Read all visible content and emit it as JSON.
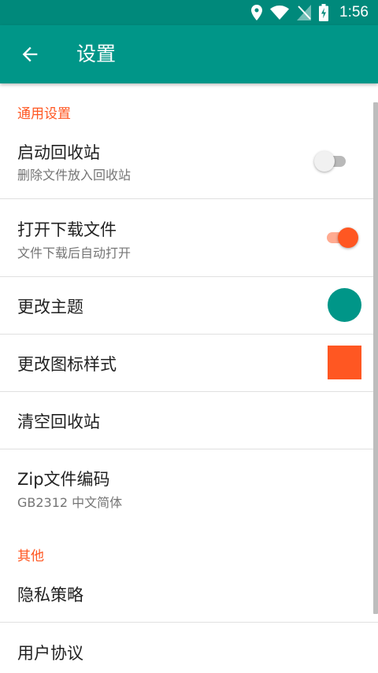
{
  "status_bar": {
    "time": "1:56",
    "icons": [
      "location-icon",
      "wifi-icon",
      "no-sim-icon",
      "battery-charging-icon"
    ]
  },
  "app_bar": {
    "title": "设置",
    "back_icon": "arrow-back-icon"
  },
  "colors": {
    "primary": "#009688",
    "primary_dark": "#00897b",
    "accent": "#ff5722"
  },
  "sections": {
    "general": {
      "header": "通用设置",
      "recycle_bin": {
        "title": "启动回收站",
        "subtitle": "删除文件放入回收站",
        "checked": false
      },
      "open_download": {
        "title": "打开下载文件",
        "subtitle": "文件下载后自动打开",
        "checked": true
      },
      "theme": {
        "title": "更改主题",
        "color": "#009688"
      },
      "icon_style": {
        "title": "更改图标样式",
        "color": "#ff5722"
      },
      "clear_bin": {
        "title": "清空回收站"
      },
      "zip_encoding": {
        "title": "Zip文件编码",
        "subtitle": "GB2312 中文简体"
      }
    },
    "other": {
      "header": "其他",
      "privacy": {
        "title": "隐私策略"
      },
      "agreement": {
        "title": "用户协议"
      }
    }
  }
}
